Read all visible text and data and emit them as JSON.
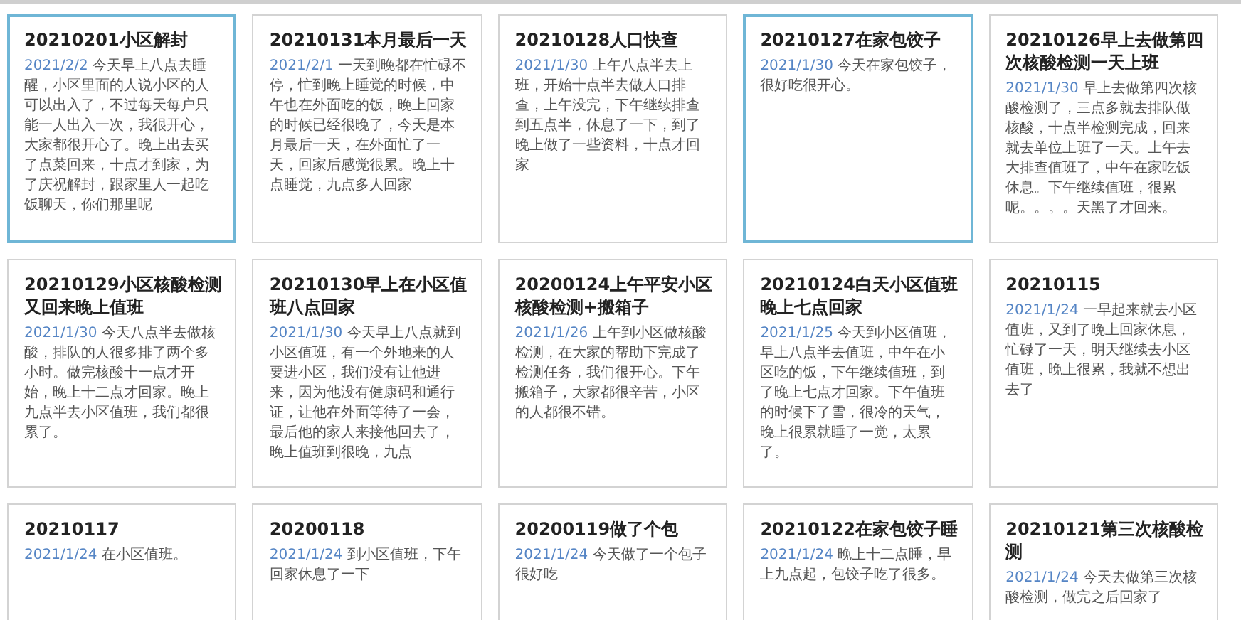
{
  "entries": [
    {
      "title": "20210201小区解封",
      "date": "2021/2/2",
      "text": "今天早上八点去睡醒，小区里面的人说小区的人可以出入了，不过每天每户只能一人出入一次，我很开心，大家都很开心了。晚上出去买了点菜回来，十点才到家，为了庆祝解封，跟家里人一起吃饭聊天，你们那里呢",
      "selected": true
    },
    {
      "title": "20210131本月最后一天",
      "date": "2021/2/1",
      "text": "一天到晚都在忙碌不停，忙到晚上睡觉的时候，中午也在外面吃的饭，晚上回家的时候已经很晚了，今天是本月最后一天，在外面忙了一天，回家后感觉很累。晚上十点睡觉，九点多人回家",
      "selected": false
    },
    {
      "title": "20210128人口快查",
      "date": "2021/1/30",
      "text": "上午八点半去上班，开始十点半去做人口排查，上午没完，下午继续排查到五点半，休息了一下，到了晚上做了一些资料，十点才回家",
      "selected": false
    },
    {
      "title": "20210127在家包饺子",
      "date": "2021/1/30",
      "text": "今天在家包饺子，很好吃很开心。",
      "selected": true
    },
    {
      "title": "20210126早上去做第四次核酸检测一天上班",
      "date": "2021/1/30",
      "text": "早上去做第四次核酸检测了，三点多就去排队做核酸，十点半检测完成，回来就去单位上班了一天。上午去大排查值班了，中午在家吃饭休息。下午继续值班，很累呢。。。。天黑了才回来。",
      "selected": false
    },
    {
      "title": "20210129小区核酸检测又回来晚上值班",
      "date": "2021/1/30",
      "text": "今天八点半去做核酸，排队的人很多排了两个多小时。做完核酸十一点才开始，晚上十二点才回家。晚上九点半去小区值班，我们都很累了。",
      "selected": false
    },
    {
      "title": "20210130早上在小区值班八点回家",
      "date": "2021/1/30",
      "text": "今天早上八点就到小区值班，有一个外地来的人要进小区，我们没有让他进来，因为他没有健康码和通行证，让他在外面等待了一会，最后他的家人来接他回去了，晚上值班到很晚，九点",
      "selected": false
    },
    {
      "title": "20200124上午平安小区核酸检测+搬箱子",
      "date": "2021/1/26",
      "text": "上午到小区做核酸检测，在大家的帮助下完成了检测任务，我们很开心。下午搬箱子，大家都很辛苦，小区的人都很不错。",
      "selected": false
    },
    {
      "title": "20210124白天小区值班晚上七点回家",
      "date": "2021/1/25",
      "text": "今天到小区值班，早上八点半去值班，中午在小区吃的饭，下午继续值班，到了晚上七点才回家。下午值班的时候下了雪，很冷的天气，晚上很累就睡了一觉，太累了。",
      "selected": false
    },
    {
      "title": "20210115",
      "date": "2021/1/24",
      "text": "一早起来就去小区值班，又到了晚上回家休息，忙碌了一天，明天继续去小区值班，晚上很累，我就不想出去了",
      "selected": false
    },
    {
      "title": "20210117",
      "date": "2021/1/24",
      "text": "在小区值班。",
      "selected": false
    },
    {
      "title": "20200118",
      "date": "2021/1/24",
      "text": "到小区值班，下午回家休息了一下",
      "selected": false
    },
    {
      "title": "20200119做了个包",
      "date": "2021/1/24",
      "text": "今天做了一个包子很好吃",
      "selected": false
    },
    {
      "title": "20210122在家包饺子睡",
      "date": "2021/1/24",
      "text": "晚上十二点睡，早上九点起，包饺子吃了很多。",
      "selected": false
    },
    {
      "title": "20210121第三次核酸检测",
      "date": "2021/1/24",
      "text": "今天去做第三次核酸检测，做完之后回家了",
      "selected": false
    }
  ]
}
